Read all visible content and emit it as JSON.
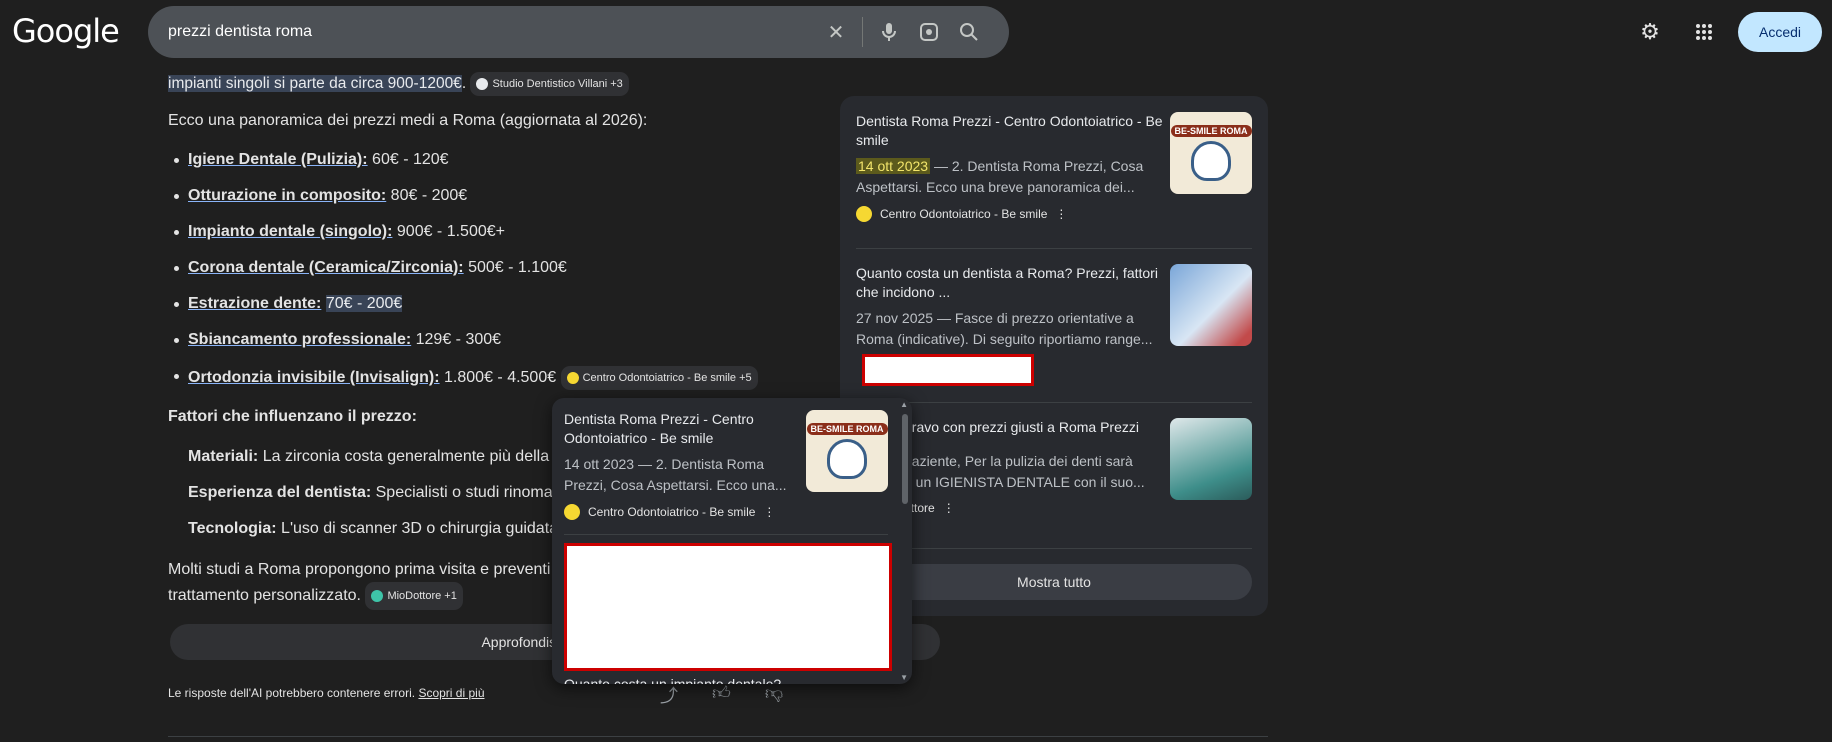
{
  "header": {
    "logo": "Google",
    "query": "prezzi dentista roma",
    "signin_label": "Accedi"
  },
  "ai_overview": {
    "intro_highlight": "impianti singoli si parte da circa 900-1200€",
    "intro_chip": "Studio Dentistico Villani +3",
    "panoramica": "Ecco una panoramica dei prezzi medi a Roma (aggiornata al 2026):",
    "prices": [
      {
        "label": "Igiene Dentale (Pulizia):",
        "value": "60€ - 120€"
      },
      {
        "label": "Otturazione in composito:",
        "value": "80€ - 200€"
      },
      {
        "label": "Impianto dentale (singolo):",
        "value": "900€ - 1.500€+"
      },
      {
        "label": "Corona dentale (Ceramica/Zirconia):",
        "value": "500€ - 1.100€"
      },
      {
        "label": "Estrazione dente:",
        "value": "70€ - 200€"
      },
      {
        "label": "Sbiancamento professionale:",
        "value": "129€ - 300€"
      },
      {
        "label": "Ortodonzia invisibile (Invisalign):",
        "value": "1.800€ - 4.500€"
      }
    ],
    "prices_chip": "Centro Odontoiatrico - Be smile +5",
    "factors_heading": "Fattori che influenzano il prezzo:",
    "factors": [
      {
        "label": "Materiali:",
        "text": "La zirconia costa generalmente più della"
      },
      {
        "label": "Esperienza del dentista:",
        "text": "Specialisti o studi rinoma"
      },
      {
        "label": "Tecnologia:",
        "text": "L'uso di scanner 3D o chirurgia guidata"
      }
    ],
    "molti": "Molti studi a Roma propongono prima visita e preventi",
    "molti2": "trattamento personalizzato.",
    "molti_chip": "MioDottore +1",
    "approfondisci": "Approfondisci in AI Mod",
    "disclaimer": "Le risposte dell'AI potrebbero contenere errori.",
    "disclaimer_link": "Scopri di più"
  },
  "sources": {
    "card1": {
      "title": "Dentista Roma Prezzi - Centro Odontoiatrico - Be smile",
      "date": "14 ott 2023",
      "snippet": "— 2. Dentista Roma Prezzi, Cosa Aspettarsi. Ecco una breve panoramica dei...",
      "source": "Centro Odontoiatrico - Be smile",
      "thumb_label": "BE-SMILE ROMA"
    },
    "card2": {
      "title": "Quanto costa un dentista a Roma? Prezzi, fattori che incidono ...",
      "snippet": "27 nov 2025 — Fasce di prezzo orientative a Roma (indicative). Di seguito riportiamo range..."
    },
    "card3": {
      "title": "bravo con prezzi giusti a Roma Prezzi",
      "snippet_line1": "paziente, Per la pulizia dei denti sarà",
      "snippet_line2": "a un IGIENISTA DENTALE con il suo...",
      "source": "ottore"
    },
    "show_all": "Mostra tutto"
  },
  "popup": {
    "card": {
      "title": "Dentista Roma Prezzi - Centro Odontoiatrico - Be smile",
      "snippet": "14 ott 2023 — 2. Dentista Roma Prezzi, Cosa Aspettarsi. Ecco una...",
      "source": "Centro Odontoiatrico - Be smile",
      "thumb_label": "BE-SMILE ROMA"
    },
    "next_title": "Quanto costa un impianto dentale?"
  },
  "colors": {
    "accent_button": "#c2e7ff",
    "highlight": "#394457",
    "red_box": "#cc0000"
  }
}
